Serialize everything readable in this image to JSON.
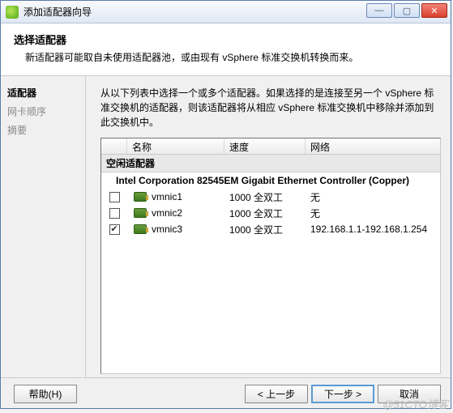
{
  "window": {
    "title": "添加适配器向导"
  },
  "header": {
    "title": "选择适配器",
    "desc": "新适配器可能取自未使用适配器池，或由现有 vSphere 标准交换机转换而来。"
  },
  "sidebar": {
    "steps": [
      {
        "label": "适配器",
        "state": "current"
      },
      {
        "label": "网卡顺序",
        "state": "pending"
      },
      {
        "label": "摘要",
        "state": "pending"
      }
    ]
  },
  "main": {
    "instructions": "从以下列表中选择一个或多个适配器。如果选择的是连接至另一个 vSphere 标准交换机的适配器，则该适配器将从相应 vSphere 标准交换机中移除并添加到此交换机中。",
    "columns": {
      "name": "名称",
      "speed": "速度",
      "network": "网络"
    },
    "group_label": "空闲适配器",
    "device_label": "Intel Corporation 82545EM Gigabit Ethernet Controller (Copper)",
    "rows": [
      {
        "checked": false,
        "name": "vmnic1",
        "speed": "1000 全双工",
        "network": "无"
      },
      {
        "checked": false,
        "name": "vmnic2",
        "speed": "1000 全双工",
        "network": "无"
      },
      {
        "checked": true,
        "name": "vmnic3",
        "speed": "1000 全双工",
        "network": "192.168.1.1-192.168.1.254"
      }
    ]
  },
  "buttons": {
    "help": "帮助(H)",
    "back": "< 上一步",
    "next": "下一步 >",
    "cancel": "取消"
  },
  "watermark": "@51CTO博客"
}
